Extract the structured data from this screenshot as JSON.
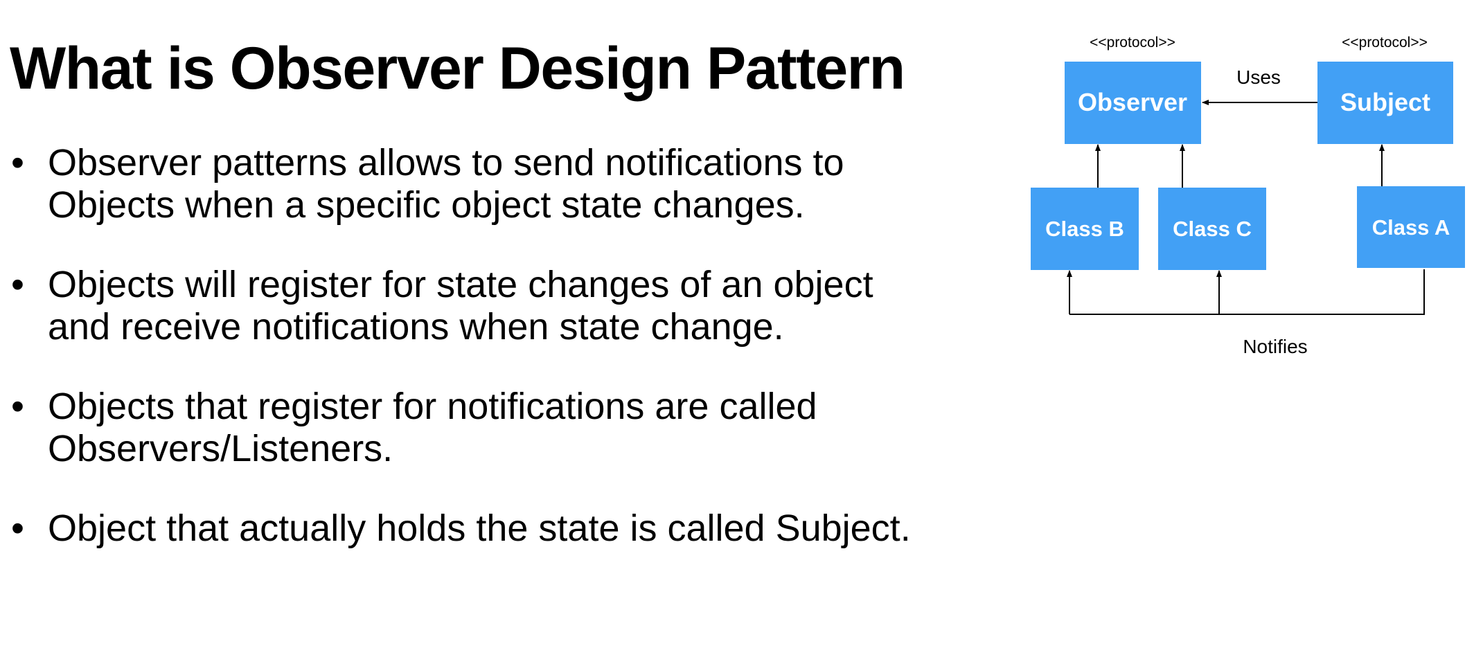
{
  "slide": {
    "title": "What is Observer Design Pattern",
    "bullets": [
      "Observer patterns allows to send notifications to Objects when a specific object state changes.",
      "Objects will register for state changes of an object and receive notifications when state change.",
      "Objects that register for notifications are called Observers/Listeners.",
      "Object that actually holds the state is called Subject."
    ]
  },
  "diagram": {
    "box_color": "#42A0F5",
    "line_color": "#000000",
    "observer": {
      "stereotype": "<<protocol>>",
      "label": "Observer"
    },
    "subject": {
      "stereotype": "<<protocol>>",
      "label": "Subject"
    },
    "class_b": {
      "label": "Class B"
    },
    "class_c": {
      "label": "Class C"
    },
    "class_a": {
      "label": "Class A"
    },
    "uses_label": "Uses",
    "notifies_label": "Notifies"
  }
}
